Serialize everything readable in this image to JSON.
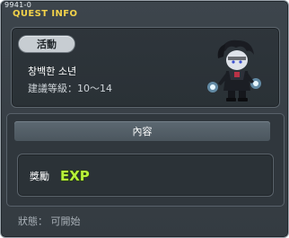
{
  "window": {
    "quest_id": "9941-0",
    "title": "QUEST INFO"
  },
  "info": {
    "tag": "活動",
    "quest_name": "창백한 소년",
    "recommended_level": "建議等級：10～14",
    "npc_icon": "pale-boy-npc-sprite"
  },
  "details": {
    "content_header": "內容",
    "reward_label": "獎勵",
    "reward_badge": "EXP",
    "reward_icon": "exp-icon"
  },
  "status": {
    "text": "狀態： 可開始"
  },
  "colors": {
    "title_yellow": "#f2d24a",
    "exp_green": "#b8f23a",
    "npc_glow": "#8fd3ff"
  }
}
